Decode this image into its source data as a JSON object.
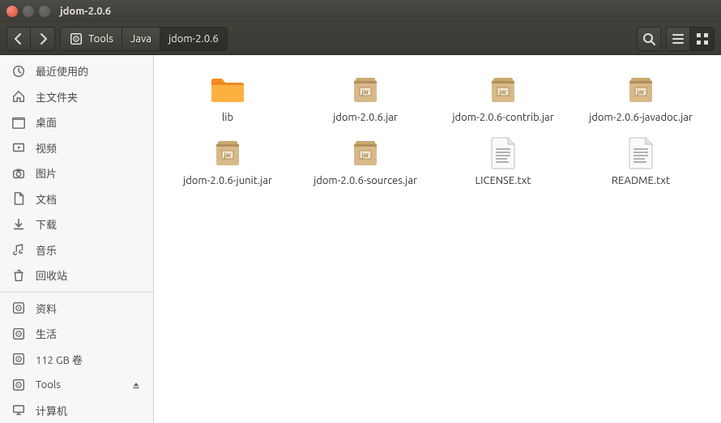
{
  "window": {
    "title": "jdom-2.0.6"
  },
  "breadcrumb": {
    "root_icon": "disk",
    "items": [
      "Tools",
      "Java",
      "jdom-2.0.6"
    ],
    "active_index": 2
  },
  "sidebar": {
    "groups": [
      [
        {
          "icon": "clock",
          "label": "最近使用的"
        },
        {
          "icon": "home",
          "label": "主文件夹"
        },
        {
          "icon": "desktop",
          "label": "桌面"
        },
        {
          "icon": "video",
          "label": "视频"
        },
        {
          "icon": "camera",
          "label": "图片"
        },
        {
          "icon": "document",
          "label": "文档"
        },
        {
          "icon": "download",
          "label": "下载"
        },
        {
          "icon": "music",
          "label": "音乐"
        },
        {
          "icon": "trash",
          "label": "回收站"
        }
      ],
      [
        {
          "icon": "disk",
          "label": "资料"
        },
        {
          "icon": "disk",
          "label": "生活"
        },
        {
          "icon": "disk",
          "label": "112 GB 卷"
        },
        {
          "icon": "disk",
          "label": "Tools",
          "eject": true
        },
        {
          "icon": "computer",
          "label": "计算机"
        }
      ]
    ]
  },
  "files": [
    {
      "type": "folder",
      "name": "lib"
    },
    {
      "type": "jar",
      "name": "jdom-2.0.6.jar"
    },
    {
      "type": "jar",
      "name": "jdom-2.0.6-contrib.jar"
    },
    {
      "type": "jar",
      "name": "jdom-2.0.6-javadoc.jar"
    },
    {
      "type": "jar",
      "name": "jdom-2.0.6-junit.jar"
    },
    {
      "type": "jar",
      "name": "jdom-2.0.6-sources.jar"
    },
    {
      "type": "text",
      "name": "LICENSE.txt"
    },
    {
      "type": "text",
      "name": "README.txt"
    }
  ]
}
